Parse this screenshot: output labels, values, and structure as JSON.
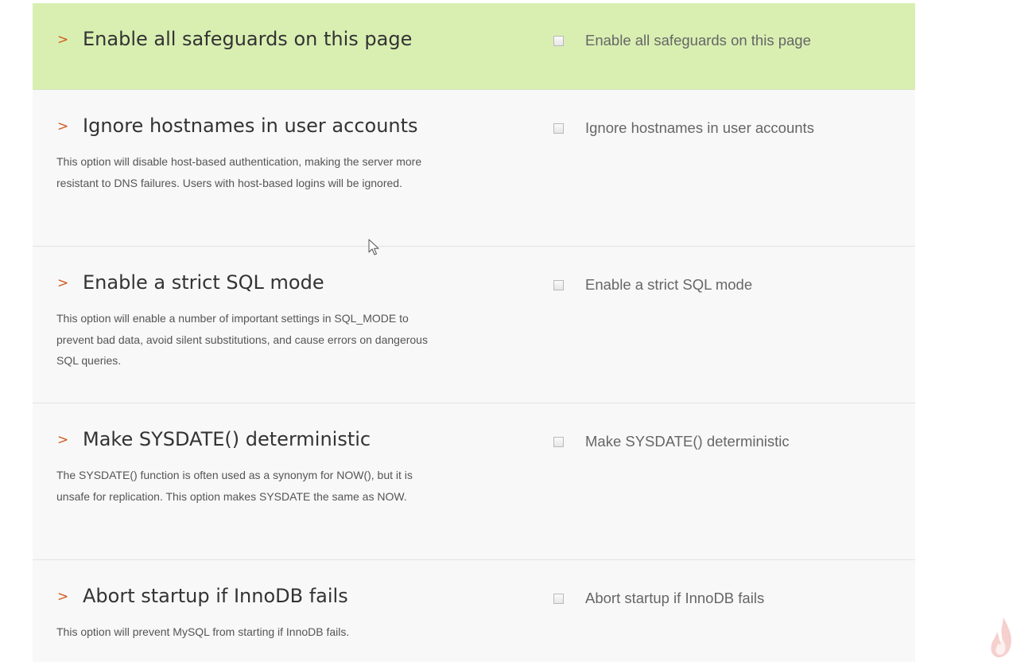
{
  "safeguards": [
    {
      "title": "Enable all safeguards on this page",
      "description": "",
      "option_label": "Enable all safeguards on this page",
      "checked": false
    },
    {
      "title": "Ignore hostnames in user accounts",
      "description": "This option will disable host-based authentication, making the server more resistant to DNS failures. Users with host-based logins will be ignored.",
      "option_label": "Ignore hostnames in user accounts",
      "checked": false
    },
    {
      "title": "Enable a strict SQL mode",
      "description": "This option will enable a number of important settings in SQL_MODE to prevent bad data, avoid silent substitutions, and cause errors on dangerous SQL queries.",
      "option_label": "Enable a strict SQL mode",
      "checked": false
    },
    {
      "title": "Make SYSDATE() deterministic",
      "description": "The SYSDATE() function is often used as a synonym for NOW(), but it is unsafe for replication. This option makes SYSDATE the same as NOW.",
      "option_label": "Make SYSDATE() deterministic",
      "checked": false
    },
    {
      "title": "Abort startup if InnoDB fails",
      "description": "This option will prevent MySQL from starting if InnoDB fails.",
      "option_label": "Abort startup if InnoDB fails",
      "checked": false
    }
  ],
  "chevron_glyph": ">",
  "colors": {
    "highlight_row": "#d9efb2",
    "panel_bg": "#f8f8f8",
    "chevron": "#d45a1e",
    "title_text": "#333333",
    "description_text": "#555555",
    "option_text": "#666666"
  },
  "icons": {
    "row_marker": "chevron-right-icon",
    "pointer": "mouse-cursor-icon",
    "corner": "flame-icon"
  }
}
